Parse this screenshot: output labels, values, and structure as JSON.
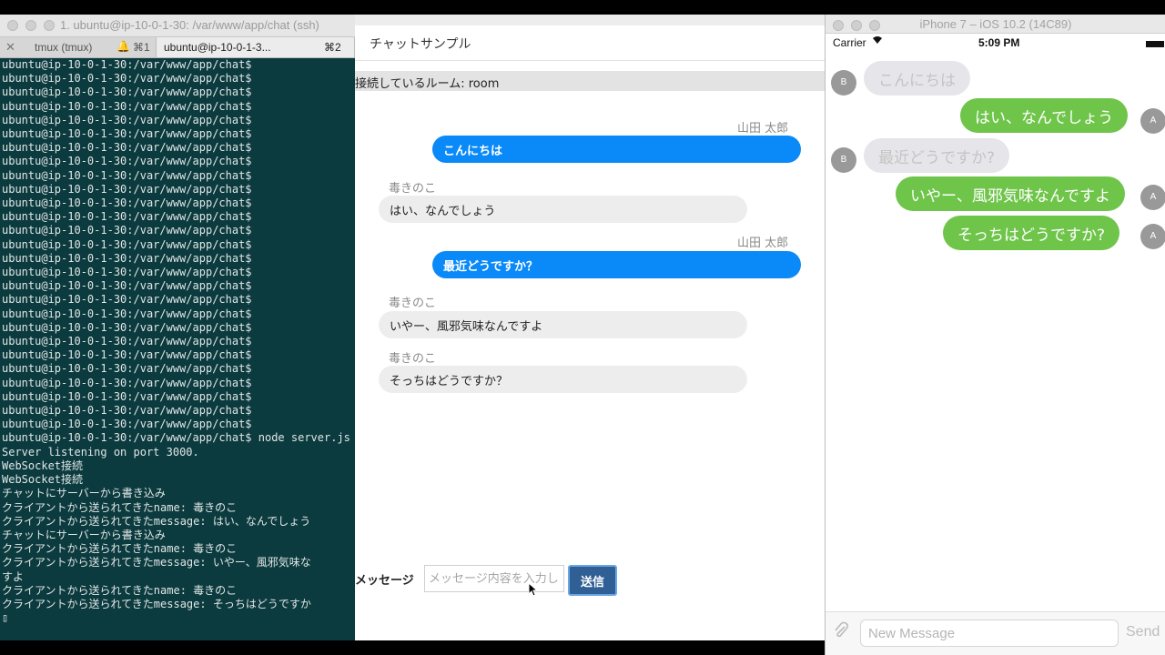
{
  "terminal": {
    "title": "1. ubuntu@ip-10-0-1-30: /var/www/app/chat (ssh)",
    "tabs": [
      {
        "label": "tmux (tmux)",
        "bell": "🔔",
        "shortcut": "⌘1"
      },
      {
        "label": "ubuntu@ip-10-0-1-3...",
        "shortcut": "⌘2"
      }
    ],
    "lines": [
      "ubuntu@ip-10-0-1-30:/var/www/app/chat$",
      "ubuntu@ip-10-0-1-30:/var/www/app/chat$",
      "ubuntu@ip-10-0-1-30:/var/www/app/chat$",
      "ubuntu@ip-10-0-1-30:/var/www/app/chat$",
      "ubuntu@ip-10-0-1-30:/var/www/app/chat$",
      "ubuntu@ip-10-0-1-30:/var/www/app/chat$",
      "ubuntu@ip-10-0-1-30:/var/www/app/chat$",
      "ubuntu@ip-10-0-1-30:/var/www/app/chat$",
      "ubuntu@ip-10-0-1-30:/var/www/app/chat$",
      "ubuntu@ip-10-0-1-30:/var/www/app/chat$",
      "ubuntu@ip-10-0-1-30:/var/www/app/chat$",
      "ubuntu@ip-10-0-1-30:/var/www/app/chat$",
      "ubuntu@ip-10-0-1-30:/var/www/app/chat$",
      "ubuntu@ip-10-0-1-30:/var/www/app/chat$",
      "ubuntu@ip-10-0-1-30:/var/www/app/chat$",
      "ubuntu@ip-10-0-1-30:/var/www/app/chat$",
      "ubuntu@ip-10-0-1-30:/var/www/app/chat$",
      "ubuntu@ip-10-0-1-30:/var/www/app/chat$",
      "ubuntu@ip-10-0-1-30:/var/www/app/chat$",
      "ubuntu@ip-10-0-1-30:/var/www/app/chat$",
      "ubuntu@ip-10-0-1-30:/var/www/app/chat$",
      "ubuntu@ip-10-0-1-30:/var/www/app/chat$",
      "ubuntu@ip-10-0-1-30:/var/www/app/chat$",
      "ubuntu@ip-10-0-1-30:/var/www/app/chat$",
      "ubuntu@ip-10-0-1-30:/var/www/app/chat$",
      "ubuntu@ip-10-0-1-30:/var/www/app/chat$",
      "ubuntu@ip-10-0-1-30:/var/www/app/chat$",
      "ubuntu@ip-10-0-1-30:/var/www/app/chat$ node server.js",
      "Server listening on port 3000.",
      "WebSocket接続",
      "WebSocket接続",
      "チャットにサーバーから書き込み",
      "クライアントから送られてきたname: 毒きのこ",
      "クライアントから送られてきたmessage: はい、なんでしょう",
      "チャットにサーバーから書き込み",
      "クライアントから送られてきたname: 毒きのこ",
      "クライアントから送られてきたmessage: いやー、風邪気味な",
      "すよ",
      "クライアントから送られてきたname: 毒きのこ",
      "クライアントから送られてきたmessage: そっちはどうですか",
      "▯"
    ]
  },
  "browser": {
    "app_title": "チャットサンプル",
    "room_label": "接続しているルーム: room",
    "messages": [
      {
        "name": "山田 太郎",
        "text": "こんにちは",
        "self": true
      },
      {
        "name": "毒きのこ",
        "text": "はい、なんでしょう",
        "self": false
      },
      {
        "name": "山田 太郎",
        "text": "最近どうですか？",
        "self": true
      },
      {
        "name": "毒きのこ",
        "text": "いやー、風邪気味なんですよ",
        "self": false
      },
      {
        "name": "毒きのこ",
        "text": "そっちはどうですか？",
        "self": false
      }
    ],
    "input_label": "メッセージ",
    "input_placeholder": "メッセージ内容を入力し",
    "send_label": "送信"
  },
  "simulator": {
    "title": "iPhone 7 – iOS 10.2 (14C89)",
    "carrier": "Carrier",
    "time": "5:09 PM",
    "messages": [
      {
        "text": "こんにちは",
        "incoming": true,
        "avatar": "B"
      },
      {
        "text": "はい、なんでしょう",
        "incoming": false,
        "avatar": "A"
      },
      {
        "text": "最近どうですか?",
        "incoming": true,
        "avatar": "B"
      },
      {
        "text": "いやー、風邪気味なんですよ",
        "incoming": false,
        "avatar": "A"
      },
      {
        "text": "そっちはどうですか?",
        "incoming": false,
        "avatar": "A"
      }
    ],
    "composer_placeholder": "New Message",
    "send_label": "Send"
  },
  "colors": {
    "terminal_bg": "#0c3b3f",
    "self_bubble": "#0a89f8",
    "ios_outgoing": "#6fc54a",
    "send_button": "#2f5f95"
  }
}
